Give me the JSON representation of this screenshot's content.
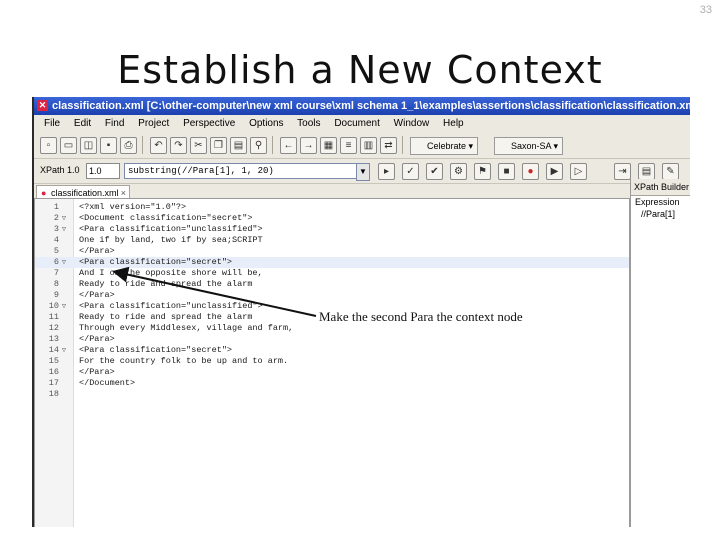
{
  "slide": {
    "number": "33",
    "title": "Establish a New Context"
  },
  "window": {
    "title": "classification.xml [C:\\other-computer\\new xml course\\xml schema 1_1\\examples\\assertions\\classification\\classification.xml] - <oXygen/>",
    "menu": [
      "File",
      "Edit",
      "Find",
      "Project",
      "Perspective",
      "Options",
      "Tools",
      "Document",
      "Window",
      "Help"
    ],
    "run_label": "Celebrate",
    "engine_label": "Saxon-SA"
  },
  "xpath": {
    "label": "XPath 1.0",
    "version": "1.0",
    "expression": "substring(//Para[1], 1, 20)"
  },
  "editor": {
    "tab_label": "classification.xml",
    "lines": [
      {
        "n": "1",
        "fold": "",
        "code": "<?xml version=\"1.0\"?>"
      },
      {
        "n": "2",
        "fold": "▽",
        "code": "<Document classification=\"secret\">"
      },
      {
        "n": "3",
        "fold": "▽",
        "code": "    <Para classification=\"unclassified\">"
      },
      {
        "n": "4",
        "fold": "",
        "code": "        One if by land, two if by sea;SCRIPT"
      },
      {
        "n": "5",
        "fold": "",
        "code": "    </Para>"
      },
      {
        "n": "6",
        "fold": "▽",
        "code": "    <Para classification=\"secret\">"
      },
      {
        "n": "7",
        "fold": "",
        "code": "        And I on the opposite shore will be,"
      },
      {
        "n": "8",
        "fold": "",
        "code": "        Ready to ride and spread the alarm"
      },
      {
        "n": "9",
        "fold": "",
        "code": "    </Para>"
      },
      {
        "n": "10",
        "fold": "▽",
        "code": "    <Para classification=\"unclassified\">"
      },
      {
        "n": "11",
        "fold": "",
        "code": "        Ready to ride and spread the alarm"
      },
      {
        "n": "12",
        "fold": "",
        "code": "        Through every Middlesex, village and farm,"
      },
      {
        "n": "13",
        "fold": "",
        "code": "    </Para>"
      },
      {
        "n": "14",
        "fold": "▽",
        "code": "    <Para classification=\"secret\">"
      },
      {
        "n": "15",
        "fold": "",
        "code": "        For the country folk to be up and to arm."
      },
      {
        "n": "16",
        "fold": "",
        "code": "    </Para>"
      },
      {
        "n": "17",
        "fold": "",
        "code": "</Document>"
      },
      {
        "n": "18",
        "fold": "",
        "code": ""
      }
    ]
  },
  "side_panel": {
    "header": "XPath Builder",
    "expression_label": "Expression",
    "tree_item": "//Para[1]"
  },
  "annotation": "Make the second Para the context node"
}
